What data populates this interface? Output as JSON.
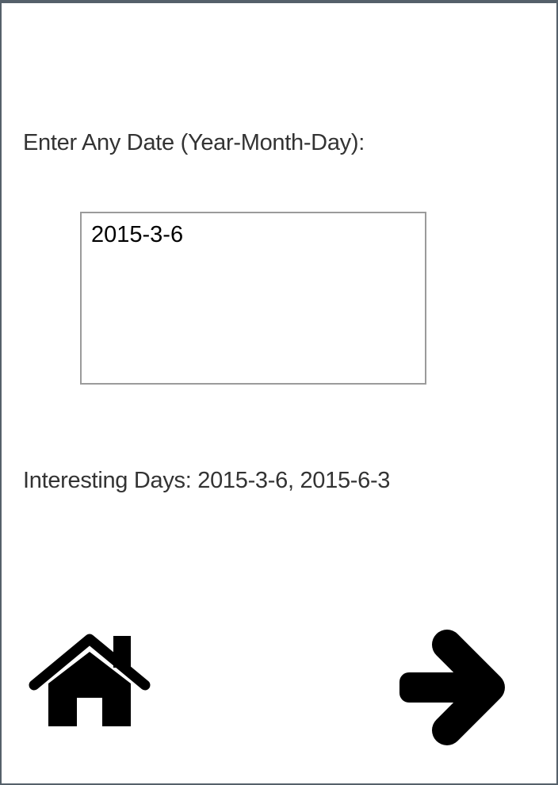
{
  "prompt": {
    "label": "Enter Any Date (Year-Month-Day):"
  },
  "date_input": {
    "value": "2015-3-6"
  },
  "result": {
    "text": "Interesting Days: 2015-3-6, 2015-6-3"
  },
  "navigation": {
    "home_icon": "home-icon",
    "next_icon": "arrow-right-icon"
  },
  "colors": {
    "frame_border": "#55606a",
    "text": "#333333",
    "input_border": "#9b9b9b",
    "icon": "#000000"
  }
}
